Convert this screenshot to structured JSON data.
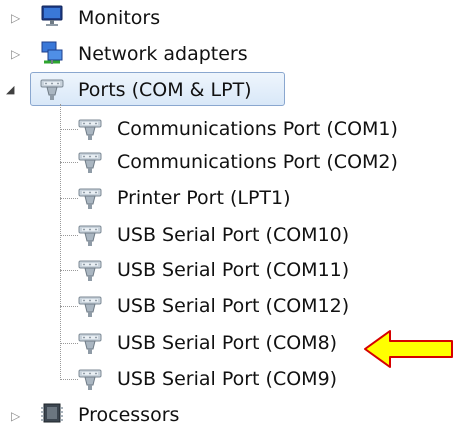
{
  "tree": {
    "items": [
      {
        "label": "Monitors",
        "icon": "monitor-icon",
        "expander": "collapsed"
      },
      {
        "label": "Network adapters",
        "icon": "network-adapter-icon",
        "expander": "collapsed"
      },
      {
        "label": "Ports (COM & LPT)",
        "icon": "port-connector-icon",
        "expander": "expanded",
        "selected": true
      },
      {
        "label": "Communications Port (COM1)",
        "icon": "port-connector-icon"
      },
      {
        "label": "Communications Port (COM2)",
        "icon": "port-connector-icon"
      },
      {
        "label": "Printer Port (LPT1)",
        "icon": "port-connector-icon"
      },
      {
        "label": "USB Serial Port (COM10)",
        "icon": "port-connector-icon"
      },
      {
        "label": "USB Serial Port (COM11)",
        "icon": "port-connector-icon"
      },
      {
        "label": "USB Serial Port (COM12)",
        "icon": "port-connector-icon"
      },
      {
        "label": "USB Serial Port (COM8)",
        "icon": "port-connector-icon",
        "highlighted_by_arrow": true
      },
      {
        "label": "USB Serial Port (COM9)",
        "icon": "port-connector-icon"
      },
      {
        "label": "Processors",
        "icon": "processor-icon",
        "expander": "collapsed"
      }
    ]
  },
  "colors": {
    "selection_border": "#8aa7cf",
    "selection_fill": "#d9e8f8",
    "arrow_fill": "#ffff00",
    "arrow_outline": "#d60000"
  }
}
